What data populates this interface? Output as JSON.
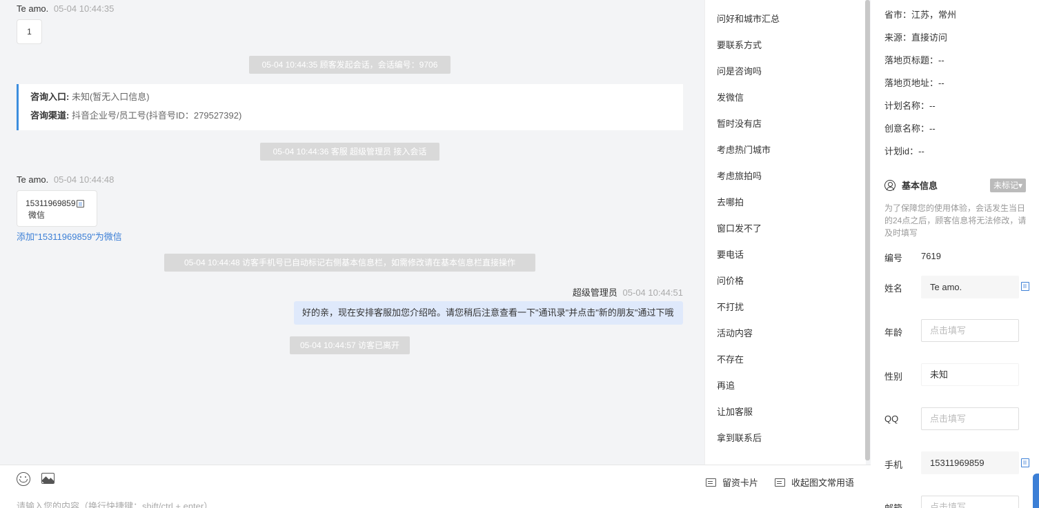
{
  "chat": {
    "msg1": {
      "sender": "Te amo.",
      "time": "05-04 10:44:35",
      "content": "1"
    },
    "sys1": "05-04 10:44:35 顾客发起会话，会话编号：9706",
    "entry": {
      "entry_label": "咨询入口:",
      "entry_value": "未知(暂无入口信息)",
      "channel_label": "咨询渠道:",
      "channel_value": "抖音企业号/员工号(抖音号ID：279527392)"
    },
    "sys2": "05-04 10:44:36 客服 超级管理员 接入会话",
    "msg2": {
      "sender": "Te amo.",
      "time": "05-04 10:44:48",
      "card_number": "15311969859",
      "card_type": "微信",
      "add_link": "添加\"15311969859\"为微信"
    },
    "sys3": "05-04 10:44:48 访客手机号已自动标记右侧基本信息栏，如需修改请在基本信息栏直接操作",
    "msg3": {
      "sender": "超级管理员",
      "time": "05-04 10:44:51",
      "content": "好的亲，现在安排客服加您介绍哈。请您稍后注意查看一下\"通讯录\"并点击\"新的朋友\"通过下哦"
    },
    "sys4": "05-04 10:44:57 访客已离开"
  },
  "phrases": [
    "问好和城市汇总",
    "要联系方式",
    "问是咨询吗",
    "发微信",
    "暂时没有店",
    "考虑热门城市",
    "考虑旅拍吗",
    "去哪拍",
    "窗口发不了",
    "要电话",
    "问价格",
    "不打扰",
    "活动内容",
    "不存在",
    "再追",
    "让加客服",
    "拿到联系后"
  ],
  "panel": {
    "province": "省市：江苏，常州",
    "source": "来源：直接访问",
    "landing_title": "落地页标题：--",
    "landing_url": "落地页地址：--",
    "plan_name": "计划名称：--",
    "creative_name": "创意名称：--",
    "plan_id": "计划id：--",
    "section_title": "基本信息",
    "tag": "未标记▾",
    "notice": "为了保障您的使用体验，会话发生当日的24点之后，顾客信息将无法修改，请及时填写",
    "id_label": "编号",
    "id_value": "7619",
    "name_label": "姓名",
    "name_value": "Te amo.",
    "age_label": "年龄",
    "age_placeholder": "点击填写",
    "gender_label": "性别",
    "gender_value": "未知",
    "qq_label": "QQ",
    "qq_placeholder": "点击填写",
    "phone_label": "手机",
    "phone_value": "15311969859",
    "email_label": "邮箱",
    "email_placeholder": "点击填写"
  },
  "inputbar": {
    "card_label": "留资卡片",
    "collapse_label": "收起图文常用语",
    "placeholder": "请输入您的内容（换行快捷键：shift/ctrl + enter）"
  }
}
